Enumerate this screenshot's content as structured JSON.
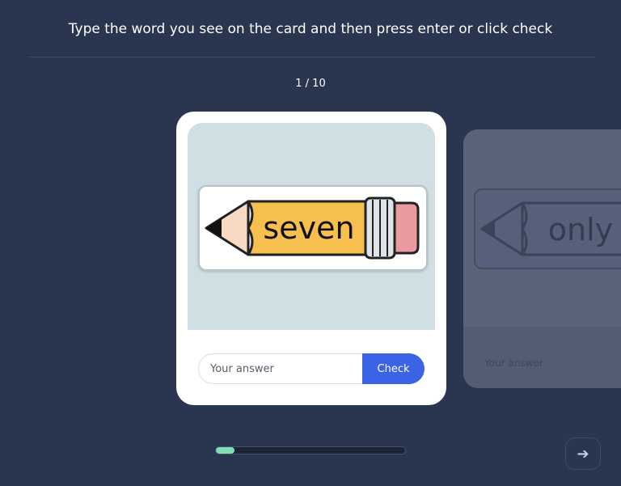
{
  "header": {
    "instruction": "Type the word you see on the card and then press enter or click check",
    "counter": "1 / 10"
  },
  "current_card": {
    "word": "seven",
    "answer_placeholder": "Your answer",
    "answer_value": "",
    "check_label": "Check"
  },
  "next_card": {
    "word": "only",
    "answer_placeholder": "Your answer"
  },
  "progress": {
    "current": 1,
    "total": 10,
    "fraction": 0.1
  },
  "footer": {
    "next_icon": "arrow-right-icon",
    "next_glyph": "➔"
  },
  "colors": {
    "background": "#2a354f",
    "card": "#ffffff",
    "card_image_bg": "#cfdfe3",
    "check_button": "#3b63e6",
    "progress_fill": "#7fe0b2",
    "pencil_body": "#f7c04e",
    "pencil_eraser": "#e89a9e"
  }
}
